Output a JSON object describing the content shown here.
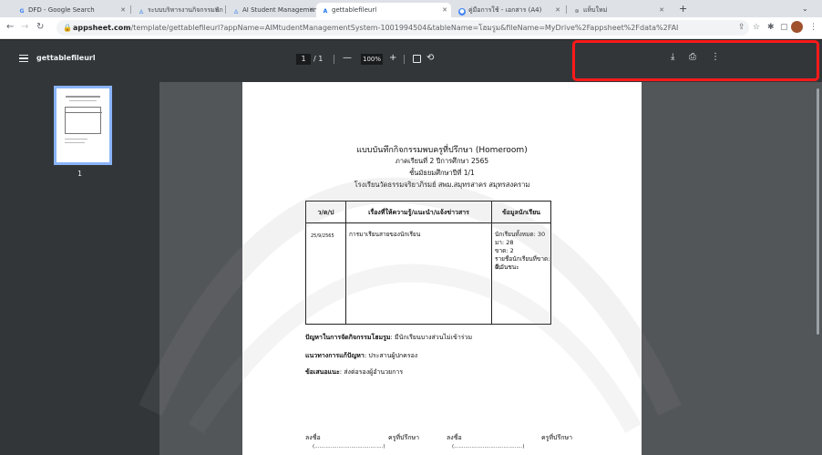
{
  "browser": {
    "tabs": [
      {
        "label": "DFD - Google Search",
        "icon": "google-icon",
        "active": false
      },
      {
        "label": "ระบบบริหารงานกิจกรรมนักเรียน",
        "icon": "appsheet-icon",
        "active": false
      },
      {
        "label": "AI Student Management S",
        "icon": "appsheet-icon",
        "active": false
      },
      {
        "label": "gettablefileurl",
        "icon": "appsheet-a-icon",
        "active": true
      },
      {
        "label": "คู่มือการใช้ - เอกสาร (A4)",
        "icon": "chrome-icon",
        "active": false
      },
      {
        "label": "แท็บใหม่",
        "icon": "new-tab-icon",
        "active": false
      }
    ],
    "new_tab": "+",
    "tab_menu": "⌄",
    "address": {
      "domain": "appsheet.com",
      "path": "/template/gettablefileurl?appName=AIMtudentManagementSystem-1001994504&tableName=โฮมรูม&fileName=MyDrive%2Fappsheet%2Fdata%2FAI"
    }
  },
  "pdf_viewer": {
    "title": "gettablefileurl",
    "page_current": "1",
    "page_total": "/ 1",
    "zoom": "100%",
    "zoom_out": "—",
    "zoom_in": "+",
    "thumbnail_label": "1"
  },
  "document": {
    "title": "แบบบันทึกกิจกรรมพบครูที่ปรึกษา (Homeroom)",
    "semester": "ภาคเรียนที่ 2 ปีการศึกษา 2565",
    "grade": "ชั้นมัธยมศึกษาปีที่ 1/1",
    "school": "โรงเรียนวัดธรรมจริยาภิรมย์ สพม.สมุทรสาคร สมุทรสงคราม",
    "table": {
      "headers": [
        "ว/ด/ป",
        "เรื่องที่ให้ความรู้/แนะนำ/แจ้งข่าวสาร",
        "ข้อมูลนักเรียน"
      ],
      "rows": [
        {
          "date": "25/9/2565",
          "topic": "การมาเรียนสายของนักเรียน",
          "student_info": [
            "นักเรียนทั้งหมด: 30",
            "มา: 28",
            "ขาด: 2",
            "รายชื่อนักเรียนที่ขาด: วัน",
            "ดี,วันชนะ"
          ]
        }
      ]
    },
    "problem_label": "ปัญหาในการจัดกิจกรรมโฮมรูม",
    "problem_text": ": มีนักเรียนบางส่วนไม่เข้าร่วม",
    "solution_label": "แนวทางการแก้ปัญหา",
    "solution_text": ": ประสานผู้ปกครอง",
    "suggestion_label": "ข้อเสนอแนะ",
    "suggestion_text": ": ส่งต่อรองผู้อำนวยการ",
    "signatures": [
      {
        "sign": "ลงชื่อ",
        "role": "ครูที่ปรึกษา",
        "blank": "(...........................................)"
      },
      {
        "sign": "ลงชื่อ",
        "role": "ครูที่ปรึกษา",
        "blank": "(...........................................)"
      }
    ]
  },
  "colors": {
    "highlight": "#ff1a1a",
    "viewer_bar": "#323639",
    "viewer_bg": "#525659",
    "thumb_selected": "#8ab4f8"
  }
}
